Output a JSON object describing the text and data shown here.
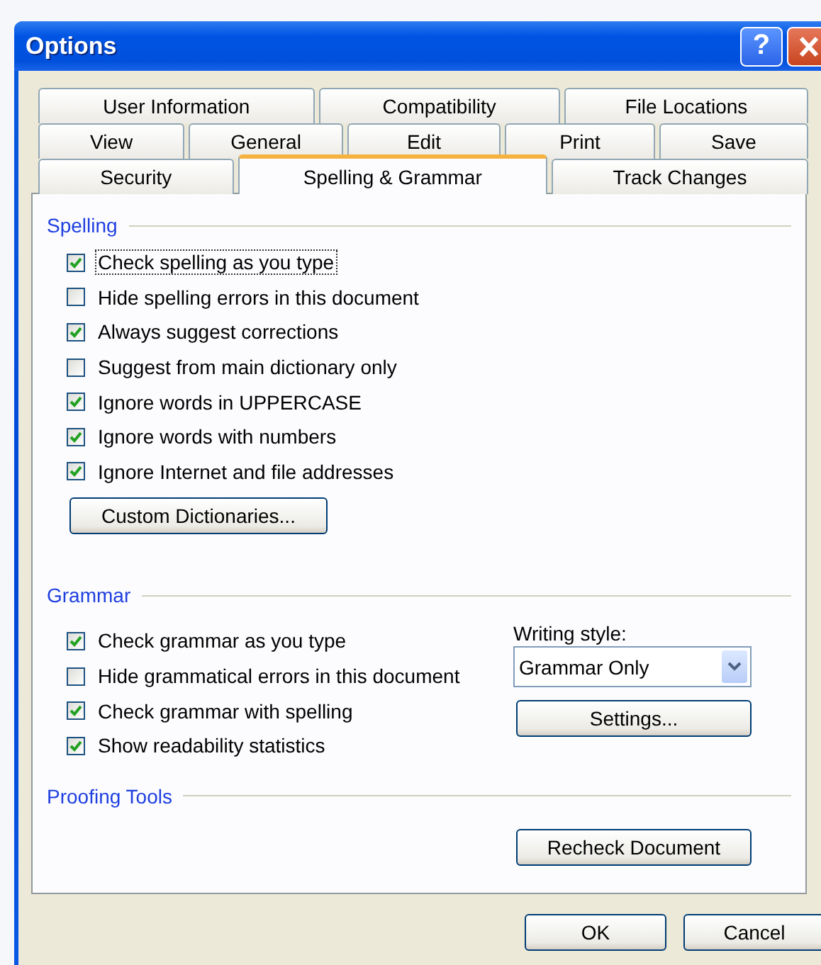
{
  "window": {
    "title": "Options",
    "help_button": "?"
  },
  "tab_rows": [
    [
      {
        "label": "User Information",
        "selected": false
      },
      {
        "label": "Compatibility",
        "selected": false
      },
      {
        "label": "File Locations",
        "selected": false
      }
    ],
    [
      {
        "label": "View",
        "selected": false
      },
      {
        "label": "General",
        "selected": false
      },
      {
        "label": "Edit",
        "selected": false
      },
      {
        "label": "Print",
        "selected": false
      },
      {
        "label": "Save",
        "selected": false
      }
    ],
    [
      {
        "label": "Security",
        "selected": false
      },
      {
        "label": "Spelling & Grammar",
        "selected": true
      },
      {
        "label": "Track Changes",
        "selected": false
      }
    ]
  ],
  "spelling": {
    "title": "Spelling",
    "options": [
      {
        "label": "Check spelling as you type",
        "checked": true,
        "focused": true
      },
      {
        "label": "Hide spelling errors in this document",
        "checked": false,
        "focused": false
      },
      {
        "label": "Always suggest corrections",
        "checked": true,
        "focused": false
      },
      {
        "label": "Suggest from main dictionary only",
        "checked": false,
        "focused": false
      },
      {
        "label": "Ignore words in UPPERCASE",
        "checked": true,
        "focused": false
      },
      {
        "label": "Ignore words with numbers",
        "checked": true,
        "focused": false
      },
      {
        "label": "Ignore Internet and file addresses",
        "checked": true,
        "focused": false
      }
    ],
    "button": "Custom Dictionaries..."
  },
  "grammar": {
    "title": "Grammar",
    "options": [
      {
        "label": "Check grammar as you type",
        "checked": true,
        "focused": false
      },
      {
        "label": "Hide grammatical errors in this document",
        "checked": false,
        "focused": false
      },
      {
        "label": "Check grammar with spelling",
        "checked": true,
        "focused": false
      },
      {
        "label": "Show readability statistics",
        "checked": true,
        "focused": false
      }
    ],
    "writing_style_label": "Writing style:",
    "writing_style": "Grammar Only",
    "settings_button": "Settings..."
  },
  "proofing_tools": {
    "title": "Proofing Tools",
    "button": "Recheck Document"
  },
  "buttons": [
    "OK",
    "Cancel"
  ]
}
